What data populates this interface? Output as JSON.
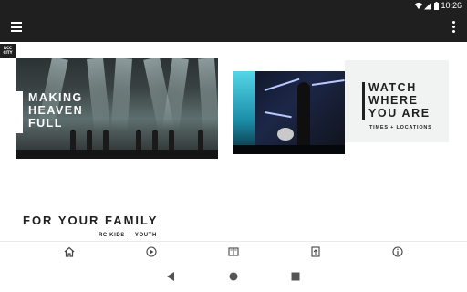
{
  "status_bar": {
    "time": "10:26",
    "icons": [
      "wifi-icon",
      "signal-icon",
      "battery-icon"
    ]
  },
  "toolbar": {
    "menu_icon": "menu-icon",
    "more_icon": "more-vert-icon"
  },
  "logo": {
    "line1": "RCC",
    "line2": "CITY"
  },
  "hero_cards": [
    {
      "title_lines": [
        "MAKING",
        "HEAVEN",
        "FULL"
      ]
    },
    {
      "title_lines": [
        "WATCH",
        "WHERE",
        "YOU ARE"
      ],
      "subtitle": "TIMES + LOCATIONS"
    }
  ],
  "family_section": {
    "heading": "FOR YOUR FAMILY",
    "tabs": [
      "RC KIDS",
      "YOUTH"
    ]
  },
  "bottom_nav": [
    {
      "icon": "home-icon"
    },
    {
      "icon": "play-icon"
    },
    {
      "icon": "book-icon"
    },
    {
      "icon": "note-upload-icon"
    },
    {
      "icon": "info-icon"
    }
  ],
  "system_nav": [
    "back-icon",
    "home-circle-icon",
    "recents-icon"
  ],
  "colors": {
    "bar": "#1f1f1f",
    "background": "#ffffff",
    "panel": "#f1f3f3"
  }
}
